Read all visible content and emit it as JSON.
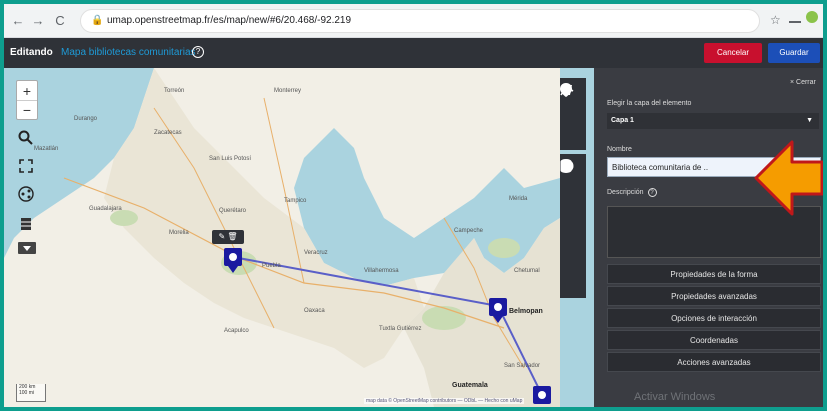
{
  "browser": {
    "url": "umap.openstreetmap.fr/es/map/new/#6/20.468/-92.219",
    "nav": {
      "back": "←",
      "forward": "→",
      "reload": "C",
      "lock": "🔒"
    },
    "icons": {
      "star": "☆",
      "menu": "⋮"
    }
  },
  "umap_header": {
    "editing_label": "Editando",
    "map_name": "Mapa bibliotecas comunitarias",
    "help_symbol": "?",
    "cancel_label": "Cancelar",
    "save_label": "Guardar",
    "cancel_color": "#c8102e",
    "save_color": "#1c4fb8"
  },
  "map": {
    "zoom_in": "+",
    "zoom_out": "−",
    "popup_icons": "✎ 🗑",
    "scale_text": [
      "200 km",
      "100 mi"
    ],
    "attribution": "map data © OpenStreetMap contributors — ODbL — Hecho con uMap",
    "place_labels": [
      "Durango",
      "Mazatlán",
      "Zacatecas",
      "San Luis Potosí",
      "Guadalajara",
      "Morelia",
      "Puebla",
      "Veracruz",
      "Oaxaca",
      "Villahermosa",
      "Campeche",
      "Mérida",
      "Chetumal",
      "Belmopan",
      "Guatemala",
      "San Salvador",
      "Tuxtla Gutiérrez",
      "Acapulco",
      "Monterrey",
      "Torreón",
      "Tampico",
      "Querétaro"
    ],
    "route_color": "#5a5fc8",
    "marker_color": "#1a1aa0"
  },
  "panel": {
    "close_label": "× Cerrar",
    "layer_label": "Elegir la capa del elemento",
    "layer_value": "Capa 1",
    "name_label": "Nombre",
    "name_value": "Biblioteca comunitaria de ..",
    "description_label": "Descripción",
    "buttons": [
      "Propiedades de la forma",
      "Propiedades avanzadas",
      "Opciones de interacción",
      "Coordenadas",
      "Acciones avanzadas"
    ],
    "watermark": "Activar Windows",
    "arrow_color": "#f59c00"
  }
}
